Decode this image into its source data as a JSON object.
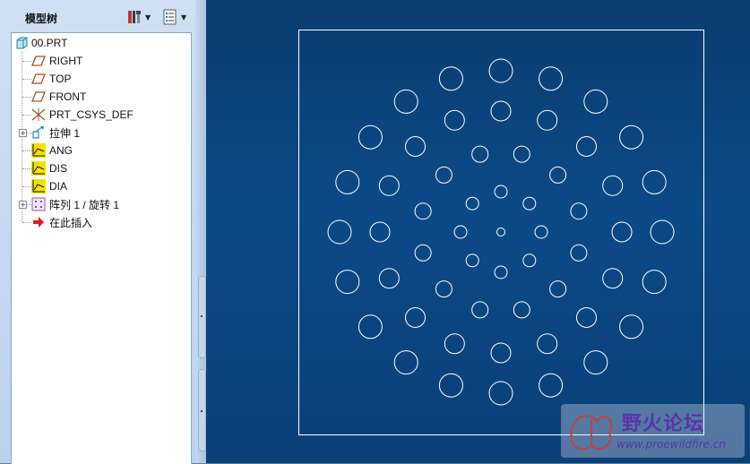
{
  "panel": {
    "title": "模型树",
    "settings_icon": "tree-settings-icon",
    "display_icon": "tree-display-icon"
  },
  "tree": {
    "root": {
      "label": "00.PRT",
      "icon": "part-icon"
    },
    "items": [
      {
        "label": "RIGHT",
        "icon": "datum-plane-icon"
      },
      {
        "label": "TOP",
        "icon": "datum-plane-icon"
      },
      {
        "label": "FRONT",
        "icon": "datum-plane-icon"
      },
      {
        "label": "PRT_CSYS_DEF",
        "icon": "coordinate-system-icon"
      },
      {
        "label": "拉伸 1",
        "icon": "extrude-icon",
        "expandable": true
      },
      {
        "label": "ANG",
        "icon": "graph-icon"
      },
      {
        "label": "DIS",
        "icon": "graph-icon"
      },
      {
        "label": "DIA",
        "icon": "graph-icon"
      },
      {
        "label": "阵列 1 / 旋转 1",
        "icon": "pattern-icon",
        "expandable": true
      },
      {
        "label": "在此插入",
        "icon": "insert-here-arrow-icon"
      }
    ]
  },
  "graphics": {
    "background_top": "#0b3c70",
    "background_bottom": "#0b3f79",
    "line_color": "#ffffff"
  },
  "watermark": {
    "title": "野火论坛",
    "url": "www.proewildfire.cn"
  }
}
